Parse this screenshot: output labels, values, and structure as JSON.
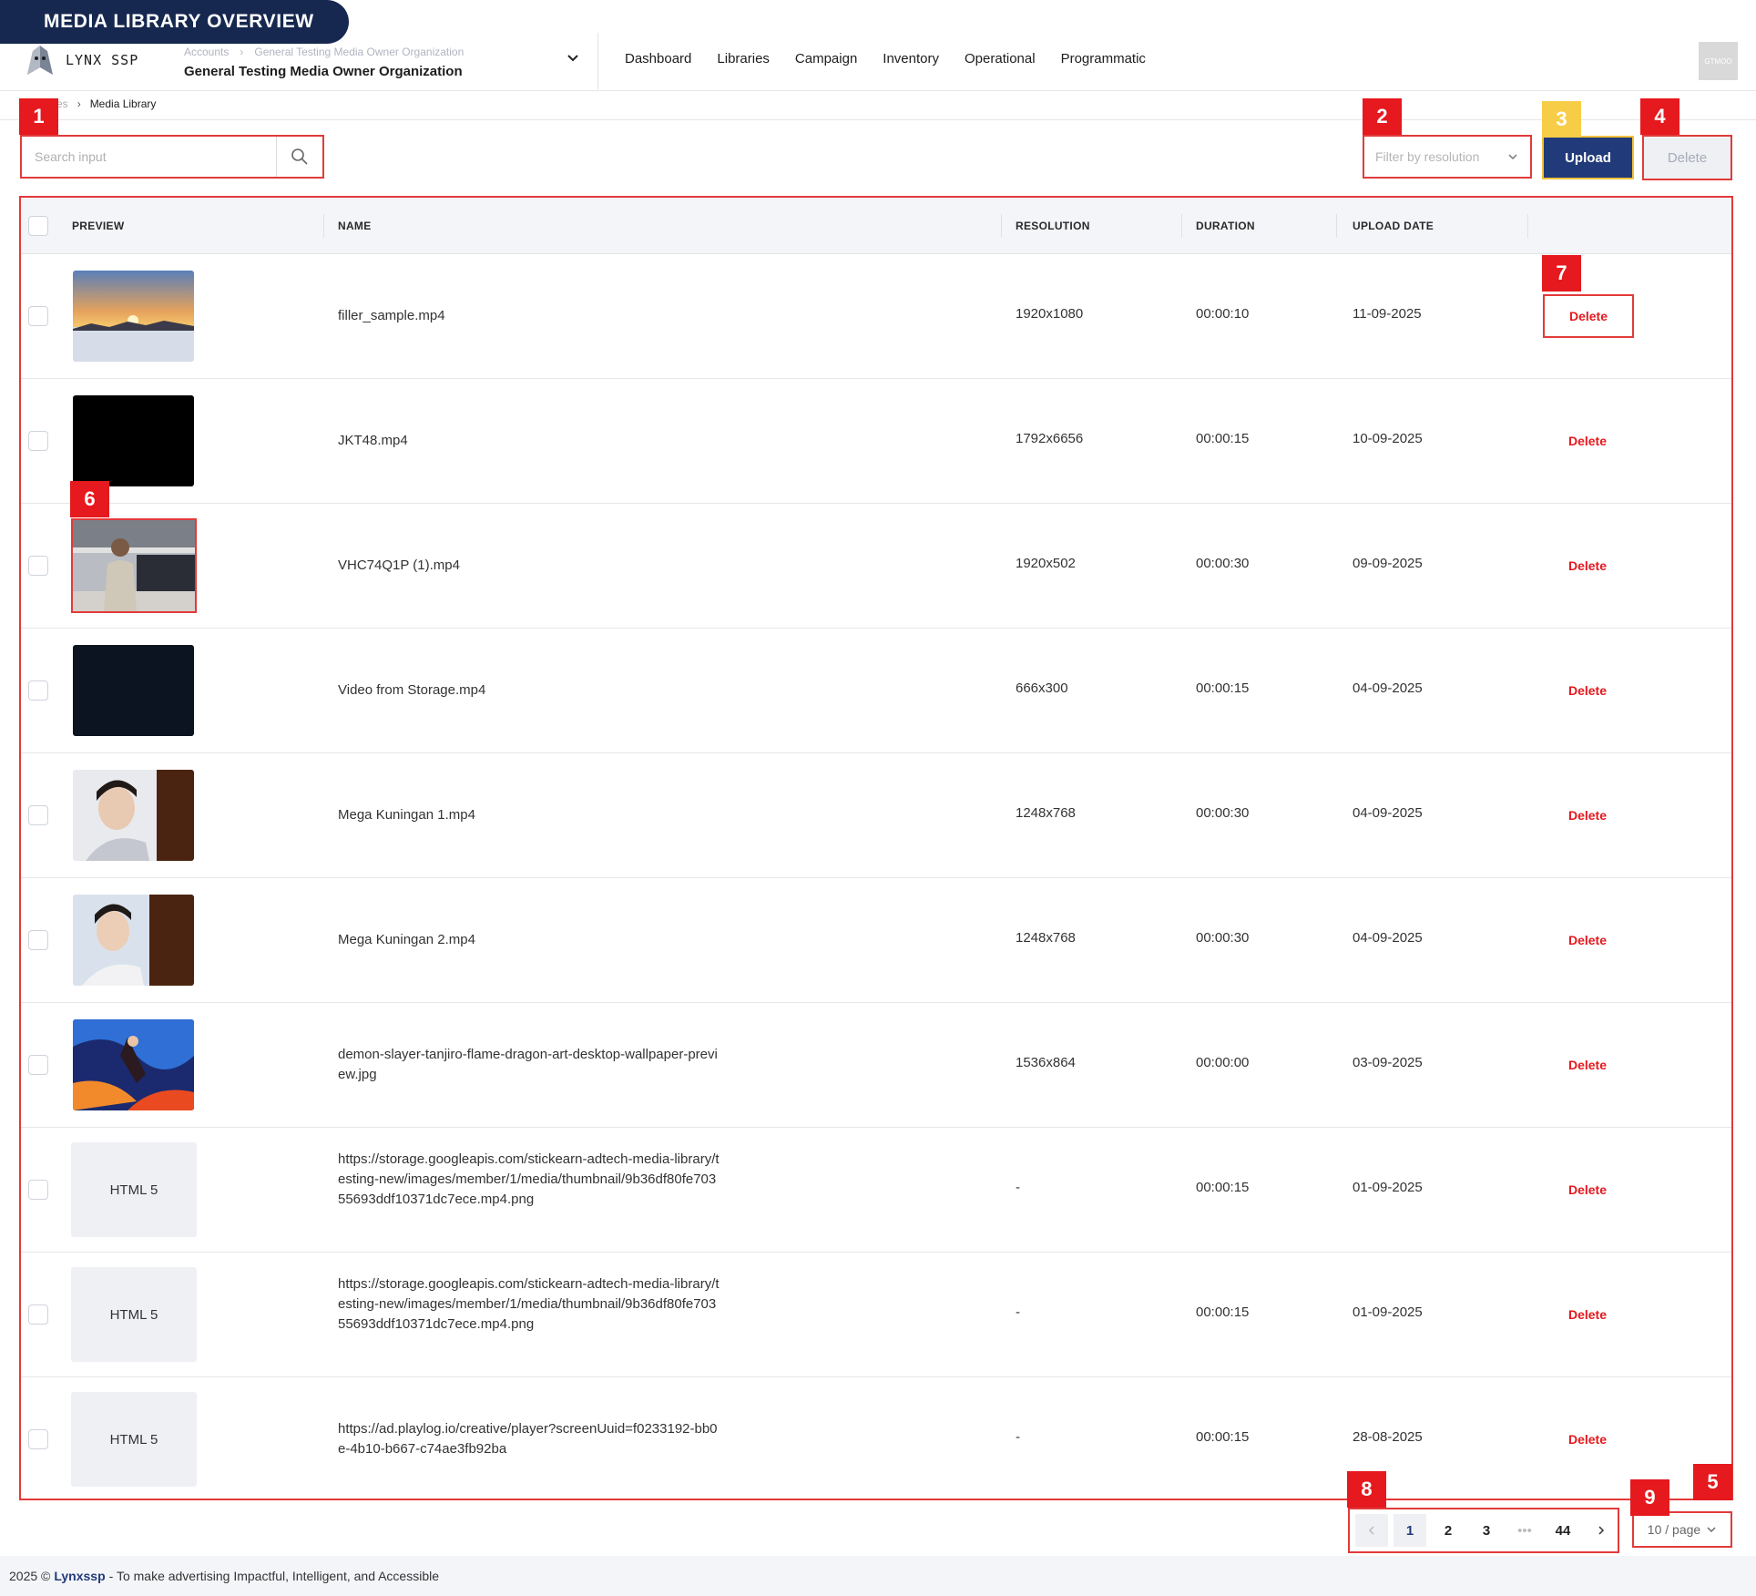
{
  "title_pill": "MEDIA LIBRARY OVERVIEW",
  "header": {
    "logo_text": "LYNX SSP",
    "crumbs": [
      "Accounts",
      "General Testing Media Owner Organization"
    ],
    "org_name": "General Testing Media Owner Organization",
    "nav": [
      "Dashboard",
      "Libraries",
      "Campaign",
      "Inventory",
      "Operational",
      "Programmatic"
    ],
    "avatar_text": "GTMOO"
  },
  "breadcrumb": {
    "prev": "es",
    "current": "Media Library"
  },
  "toolbar": {
    "search_placeholder": "Search input",
    "filter_placeholder": "Filter by resolution",
    "upload_label": "Upload",
    "delete_label": "Delete"
  },
  "badges": [
    "1",
    "2",
    "3",
    "4",
    "5",
    "6",
    "7",
    "8",
    "9"
  ],
  "table": {
    "headers": [
      "PREVIEW",
      "NAME",
      "RESOLUTION",
      "DURATION",
      "UPLOAD DATE"
    ],
    "rows": [
      {
        "name": "filler_sample.mp4",
        "resolution": "1920x1080",
        "duration": "00:00:10",
        "date": "11-09-2025",
        "action": "Delete",
        "preview": "sunset"
      },
      {
        "name": "JKT48.mp4",
        "resolution": "1792x6656",
        "duration": "00:00:15",
        "date": "10-09-2025",
        "action": "Delete",
        "preview": "black"
      },
      {
        "name": "VHC74Q1P (1).mp4",
        "resolution": "1920x502",
        "duration": "00:00:30",
        "date": "09-09-2025",
        "action": "Delete",
        "preview": "station"
      },
      {
        "name": "Video from Storage.mp4",
        "resolution": "666x300",
        "duration": "00:00:15",
        "date": "04-09-2025",
        "action": "Delete",
        "preview": "dark"
      },
      {
        "name": "Mega Kuningan 1.mp4",
        "resolution": "1248x768",
        "duration": "00:00:30",
        "date": "04-09-2025",
        "action": "Delete",
        "preview": "portrait"
      },
      {
        "name": "Mega Kuningan 2.mp4",
        "resolution": "1248x768",
        "duration": "00:00:30",
        "date": "04-09-2025",
        "action": "Delete",
        "preview": "portrait2"
      },
      {
        "name": "demon-slayer-tanjiro-flame-dragon-art-desktop-wallpaper-preview.jpg",
        "resolution": "1536x864",
        "duration": "00:00:00",
        "date": "03-09-2025",
        "action": "Delete",
        "preview": "anime"
      },
      {
        "name": "https://storage.googleapis.com/stickearn-adtech-media-library/testing-new/images/member/1/media/thumbnail/9b36df80fe70355693ddf10371dc7ece.mp4.png",
        "resolution": "-",
        "duration": "00:00:15",
        "date": "01-09-2025",
        "action": "Delete",
        "preview": "HTML 5"
      },
      {
        "name": "https://storage.googleapis.com/stickearn-adtech-media-library/testing-new/images/member/1/media/thumbnail/9b36df80fe70355693ddf10371dc7ece.mp4.png",
        "resolution": "-",
        "duration": "00:00:15",
        "date": "01-09-2025",
        "action": "Delete",
        "preview": "HTML 5"
      },
      {
        "name": "https://ad.playlog.io/creative/player?screenUuid=f0233192-bb0e-4b10-b667-c74ae3fb92ba",
        "resolution": "-",
        "duration": "00:00:15",
        "date": "28-08-2025",
        "action": "Delete",
        "preview": "HTML 5"
      }
    ]
  },
  "pagination": {
    "pages": [
      "1",
      "2",
      "3",
      "•••",
      "44"
    ],
    "current": "1",
    "per_page": "10 / page"
  },
  "footer": {
    "year": "2025 ©",
    "brand": "Lynxssp",
    "tagline": "- To make advertising Impactful, Intelligent, and Accessible"
  },
  "colors": {
    "accent_red": "#e5191e",
    "primary_blue": "#213b7a",
    "highlight_yellow": "#f7cd47"
  }
}
